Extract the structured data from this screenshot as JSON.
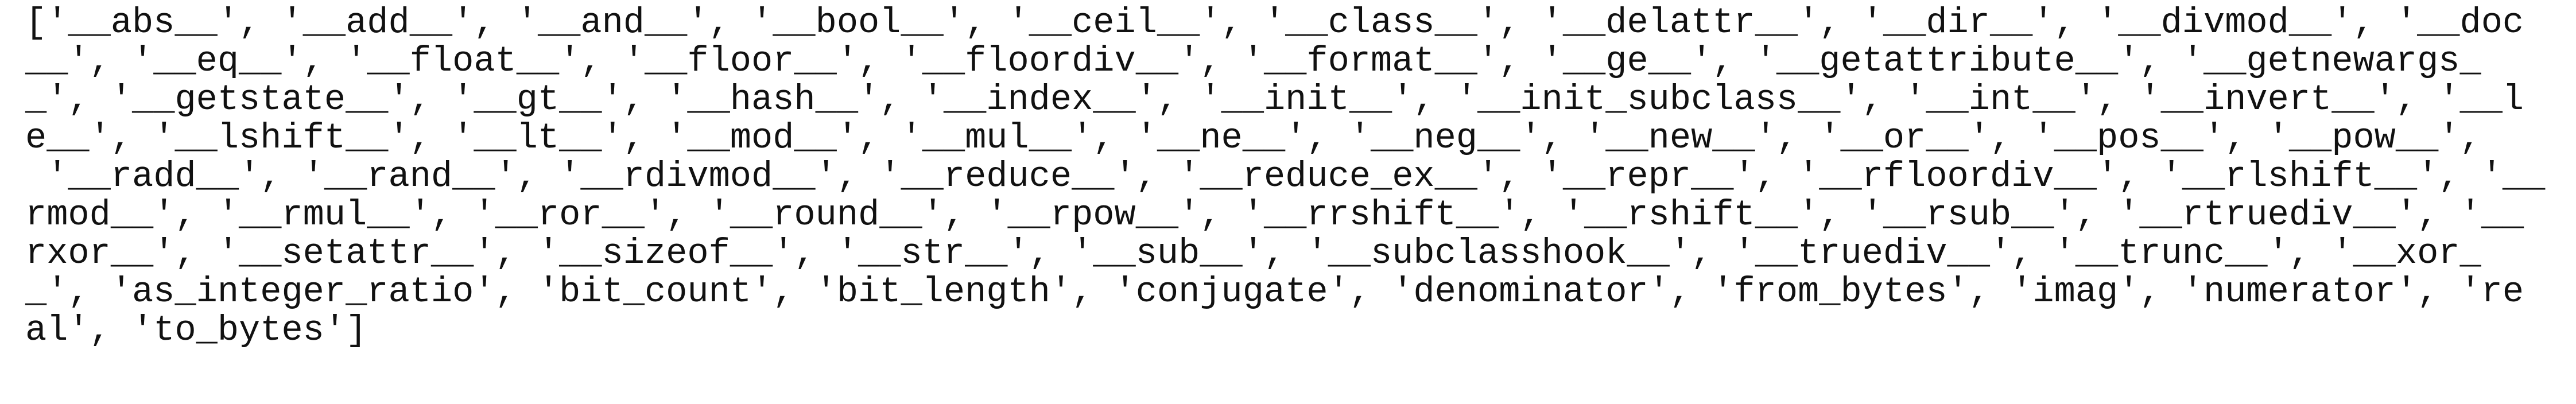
{
  "output": {
    "kind": "python-dir-listing",
    "lines": [
      "['__abs__', '__add__', '__and__', '__bool__', '__ceil__', '__class__', '__delattr__', '__dir__', '__divmod__', '__doc",
      "__', '__eq__', '__float__', '__floor__', '__floordiv__', '__format__', '__ge__', '__getattribute__', '__getnewargs_",
      "_', '__getstate__', '__gt__', '__hash__', '__index__', '__init__', '__init_subclass__', '__int__', '__invert__', '__l",
      "e__', '__lshift__', '__lt__', '__mod__', '__mul__', '__ne__', '__neg__', '__new__', '__or__', '__pos__', '__pow__',",
      " '__radd__', '__rand__', '__rdivmod__', '__reduce__', '__reduce_ex__', '__repr__', '__rfloordiv__', '__rlshift__', '__",
      "rmod__', '__rmul__', '__ror__', '__round__', '__rpow__', '__rrshift__', '__rshift__', '__rsub__', '__rtruediv__', '__",
      "rxor__', '__setattr__', '__sizeof__', '__str__', '__sub__', '__subclasshook__', '__truediv__', '__trunc__', '__xor_",
      "_', 'as_integer_ratio', 'bit_count', 'bit_length', 'conjugate', 'denominator', 'from_bytes', 'imag', 'numerator', 're",
      "al', 'to_bytes']"
    ],
    "items": [
      "__abs__",
      "__add__",
      "__and__",
      "__bool__",
      "__ceil__",
      "__class__",
      "__delattr__",
      "__dir__",
      "__divmod__",
      "__doc__",
      "__eq__",
      "__float__",
      "__floor__",
      "__floordiv__",
      "__format__",
      "__ge__",
      "__getattribute__",
      "__getnewargs__",
      "__getstate__",
      "__gt__",
      "__hash__",
      "__index__",
      "__init__",
      "__init_subclass__",
      "__int__",
      "__invert__",
      "__le__",
      "__lshift__",
      "__lt__",
      "__mod__",
      "__mul__",
      "__ne__",
      "__neg__",
      "__new__",
      "__or__",
      "__pos__",
      "__pow__",
      "__radd__",
      "__rand__",
      "__rdivmod__",
      "__reduce__",
      "__reduce_ex__",
      "__repr__",
      "__rfloordiv__",
      "__rlshift__",
      "__rmod__",
      "__rmul__",
      "__ror__",
      "__round__",
      "__rpow__",
      "__rrshift__",
      "__rshift__",
      "__rsub__",
      "__rtruediv__",
      "__rxor__",
      "__setattr__",
      "__sizeof__",
      "__str__",
      "__sub__",
      "__subclasshook__",
      "__truediv__",
      "__trunc__",
      "__xor__",
      "as_integer_ratio",
      "bit_count",
      "bit_length",
      "conjugate",
      "denominator",
      "from_bytes",
      "imag",
      "numerator",
      "real",
      "to_bytes"
    ]
  },
  "colors": {
    "background": "#ffffff",
    "text": "#111111"
  }
}
